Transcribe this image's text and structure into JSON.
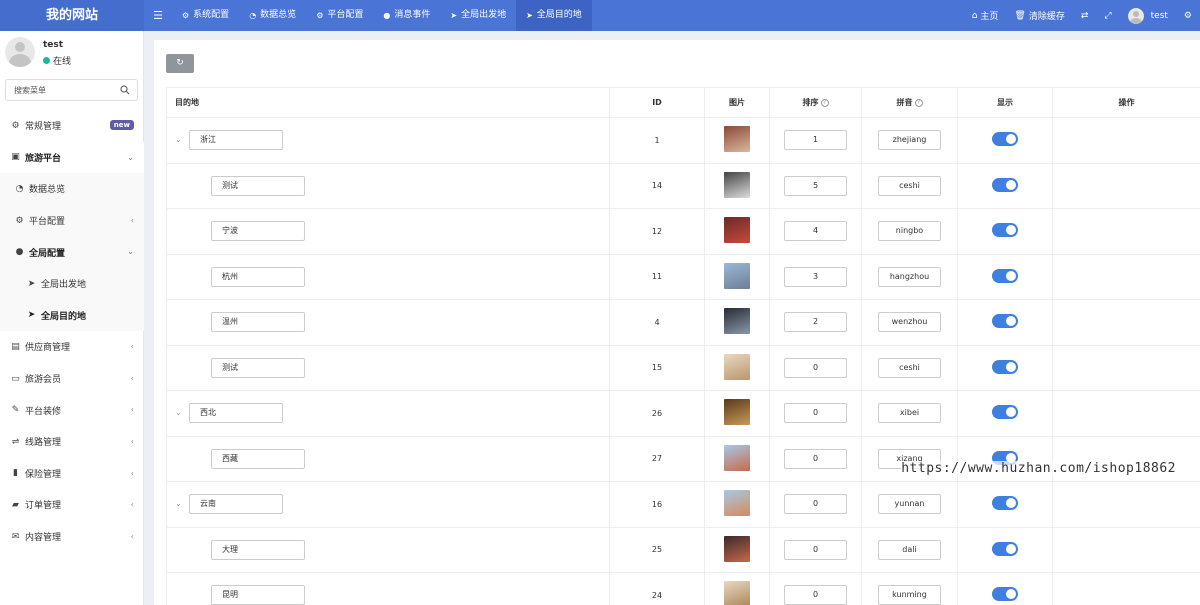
{
  "header": {
    "brand": "我的网站",
    "tabs": [
      {
        "label": "系统配置",
        "icon": "gear-icon"
      },
      {
        "label": "数据总览",
        "icon": "dashboard-icon"
      },
      {
        "label": "平台配置",
        "icon": "gear-icon"
      },
      {
        "label": "消息事件",
        "icon": "chat-icon"
      },
      {
        "label": "全局出发地",
        "icon": "paper-plane-icon"
      },
      {
        "label": "全局目的地",
        "icon": "paper-plane-icon"
      }
    ],
    "active_tab": 5,
    "right": {
      "home": "主页",
      "clear_cache": "清除缓存",
      "user": "test"
    }
  },
  "sidebar": {
    "user": {
      "name": "test",
      "status": "在线"
    },
    "search_placeholder": "搜索菜单",
    "items": [
      {
        "label": "常规管理",
        "icon": "gears-icon",
        "badge": "new"
      },
      {
        "label": "旅游平台",
        "icon": "bus-icon",
        "arrow": "⌄"
      },
      {
        "label": "数据总览",
        "icon": "dashboard-icon"
      },
      {
        "label": "平台配置",
        "icon": "gears-icon",
        "arrow": "‹"
      },
      {
        "label": "全局配置",
        "icon": "info-circle-icon",
        "arrow": "⌄"
      },
      {
        "label": "全局出发地",
        "icon": "paper-plane-icon"
      },
      {
        "label": "全局目的地",
        "icon": "paper-plane-icon"
      },
      {
        "label": "供应商管理",
        "icon": "address-book-icon",
        "arrow": "‹"
      },
      {
        "label": "旅游会员",
        "icon": "id-card-icon",
        "arrow": "‹"
      },
      {
        "label": "平台装修",
        "icon": "brush-icon",
        "arrow": "‹"
      },
      {
        "label": "线路管理",
        "icon": "usb-icon",
        "arrow": "‹"
      },
      {
        "label": "保险管理",
        "icon": "file-icon",
        "arrow": "‹"
      },
      {
        "label": "订单管理",
        "icon": "folder-icon",
        "arrow": "‹"
      },
      {
        "label": "内容管理",
        "icon": "envelope-icon",
        "arrow": "‹"
      }
    ]
  },
  "table": {
    "columns": [
      "目的地",
      "ID",
      "图片",
      "排序",
      "拼音",
      "显示",
      "操作"
    ],
    "rows": [
      {
        "name": "浙江",
        "level": 0,
        "id": "1",
        "sort": "1",
        "pinyin": "zhejiang",
        "img": [
          "#8a4a3a",
          "#d9b89a"
        ]
      },
      {
        "name": "测试",
        "level": 1,
        "id": "14",
        "sort": "5",
        "pinyin": "ceshi",
        "img": [
          "#444444",
          "#dddddd"
        ]
      },
      {
        "name": "宁波",
        "level": 1,
        "id": "12",
        "sort": "4",
        "pinyin": "ningbo",
        "img": [
          "#6a2a2a",
          "#c84a3a"
        ]
      },
      {
        "name": "杭州",
        "level": 1,
        "id": "11",
        "sort": "3",
        "pinyin": "hangzhou",
        "img": [
          "#9bb8d6",
          "#6c7f95"
        ]
      },
      {
        "name": "温州",
        "level": 1,
        "id": "4",
        "sort": "2",
        "pinyin": "wenzhou",
        "img": [
          "#2a2a35",
          "#8899aa"
        ]
      },
      {
        "name": "测试",
        "level": 1,
        "id": "15",
        "sort": "0",
        "pinyin": "ceshi",
        "img": [
          "#e9d8c0",
          "#b89670"
        ]
      },
      {
        "name": "西北",
        "level": 0,
        "id": "26",
        "sort": "0",
        "pinyin": "xibei",
        "img": [
          "#5a3a1a",
          "#c89a5a"
        ]
      },
      {
        "name": "西藏",
        "level": 1,
        "id": "27",
        "sort": "0",
        "pinyin": "xizang",
        "img": [
          "#a6c8e6",
          "#c86a4a"
        ]
      },
      {
        "name": "云南",
        "level": 0,
        "id": "16",
        "sort": "0",
        "pinyin": "yunnan",
        "img": [
          "#a6c8e6",
          "#d88a5a"
        ]
      },
      {
        "name": "大理",
        "level": 1,
        "id": "25",
        "sort": "0",
        "pinyin": "dali",
        "img": [
          "#3a2a2a",
          "#c8684a"
        ]
      },
      {
        "name": "昆明",
        "level": 1,
        "id": "24",
        "sort": "0",
        "pinyin": "kunming",
        "img": [
          "#e9d8c0",
          "#a8865a"
        ]
      }
    ]
  },
  "watermark": "https://www.huzhan.com/ishop18862"
}
